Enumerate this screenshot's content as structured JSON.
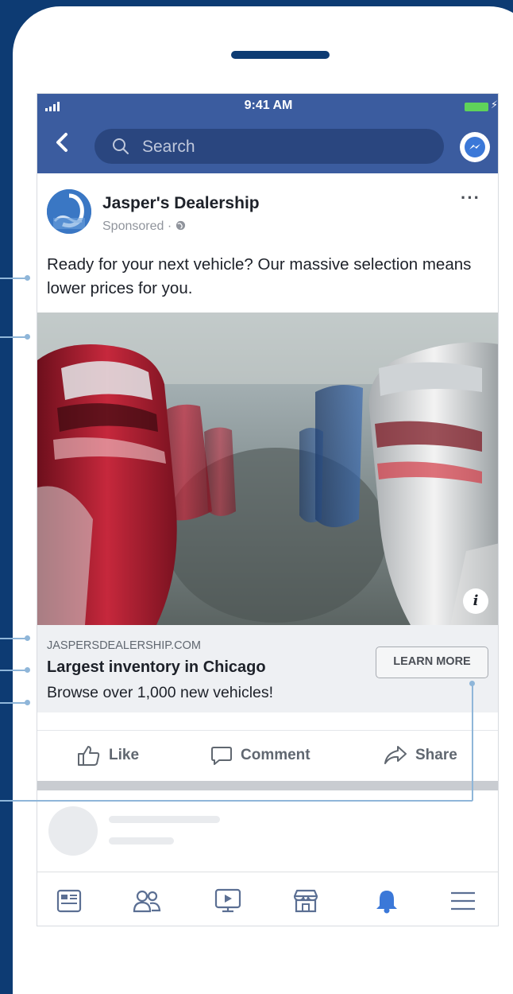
{
  "status_bar": {
    "signal": "..ıl",
    "time": "9:41 AM"
  },
  "search": {
    "placeholder": "Search"
  },
  "post": {
    "page_name": "Jasper's Dealership",
    "sponsored": "Sponsored · ",
    "more": "···",
    "text": "Ready for your next vehicle? Our massive selection means lower prices for you.",
    "image_description_icon": "info-icon"
  },
  "link_card": {
    "domain": "JASPERSDEALERSHIP.COM",
    "headline": "Largest inventory in Chicago",
    "description": "Browse over 1,000 new vehicles!",
    "cta": "LEARN MORE"
  },
  "actions": {
    "like": "Like",
    "comment": "Comment",
    "share": "Share"
  },
  "bottom_nav": [
    "news-feed-icon",
    "friends-icon",
    "watch-icon",
    "marketplace-icon",
    "notifications-icon",
    "menu-icon"
  ],
  "colors": {
    "background": "#0d3b73",
    "facebook_blue": "#3b5c9f",
    "callout": "#8fb6d9",
    "accent": "#3b78d8"
  }
}
